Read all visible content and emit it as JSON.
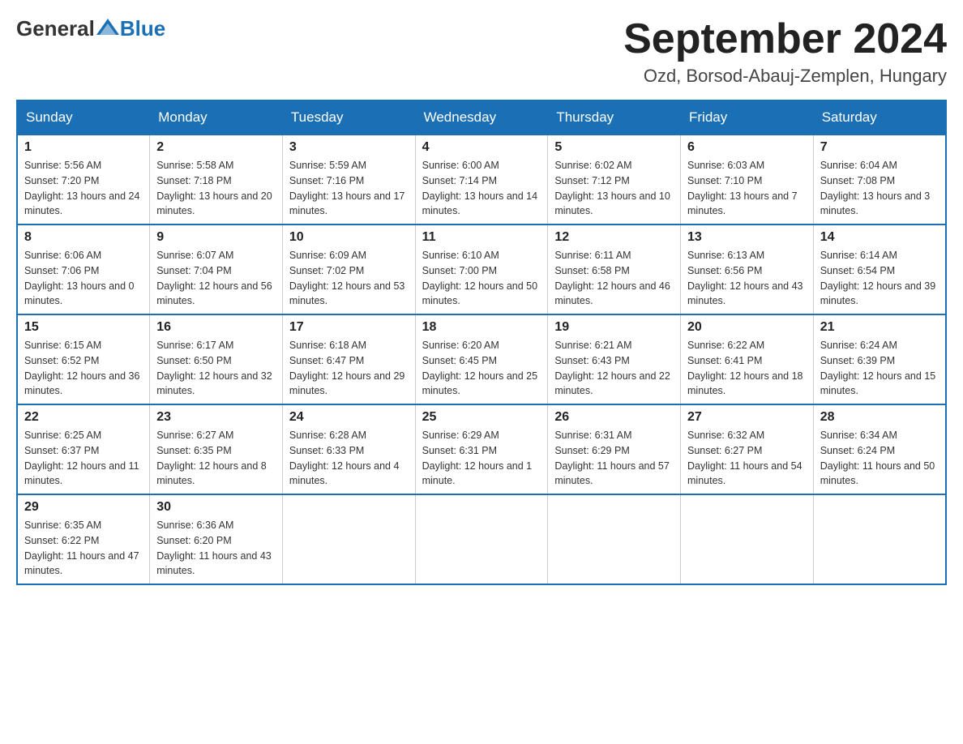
{
  "header": {
    "month_year": "September 2024",
    "location": "Ozd, Borsod-Abauj-Zemplen, Hungary",
    "logo_general": "General",
    "logo_blue": "Blue"
  },
  "days_of_week": [
    "Sunday",
    "Monday",
    "Tuesday",
    "Wednesday",
    "Thursday",
    "Friday",
    "Saturday"
  ],
  "weeks": [
    [
      {
        "day": "1",
        "sunrise": "Sunrise: 5:56 AM",
        "sunset": "Sunset: 7:20 PM",
        "daylight": "Daylight: 13 hours and 24 minutes."
      },
      {
        "day": "2",
        "sunrise": "Sunrise: 5:58 AM",
        "sunset": "Sunset: 7:18 PM",
        "daylight": "Daylight: 13 hours and 20 minutes."
      },
      {
        "day": "3",
        "sunrise": "Sunrise: 5:59 AM",
        "sunset": "Sunset: 7:16 PM",
        "daylight": "Daylight: 13 hours and 17 minutes."
      },
      {
        "day": "4",
        "sunrise": "Sunrise: 6:00 AM",
        "sunset": "Sunset: 7:14 PM",
        "daylight": "Daylight: 13 hours and 14 minutes."
      },
      {
        "day": "5",
        "sunrise": "Sunrise: 6:02 AM",
        "sunset": "Sunset: 7:12 PM",
        "daylight": "Daylight: 13 hours and 10 minutes."
      },
      {
        "day": "6",
        "sunrise": "Sunrise: 6:03 AM",
        "sunset": "Sunset: 7:10 PM",
        "daylight": "Daylight: 13 hours and 7 minutes."
      },
      {
        "day": "7",
        "sunrise": "Sunrise: 6:04 AM",
        "sunset": "Sunset: 7:08 PM",
        "daylight": "Daylight: 13 hours and 3 minutes."
      }
    ],
    [
      {
        "day": "8",
        "sunrise": "Sunrise: 6:06 AM",
        "sunset": "Sunset: 7:06 PM",
        "daylight": "Daylight: 13 hours and 0 minutes."
      },
      {
        "day": "9",
        "sunrise": "Sunrise: 6:07 AM",
        "sunset": "Sunset: 7:04 PM",
        "daylight": "Daylight: 12 hours and 56 minutes."
      },
      {
        "day": "10",
        "sunrise": "Sunrise: 6:09 AM",
        "sunset": "Sunset: 7:02 PM",
        "daylight": "Daylight: 12 hours and 53 minutes."
      },
      {
        "day": "11",
        "sunrise": "Sunrise: 6:10 AM",
        "sunset": "Sunset: 7:00 PM",
        "daylight": "Daylight: 12 hours and 50 minutes."
      },
      {
        "day": "12",
        "sunrise": "Sunrise: 6:11 AM",
        "sunset": "Sunset: 6:58 PM",
        "daylight": "Daylight: 12 hours and 46 minutes."
      },
      {
        "day": "13",
        "sunrise": "Sunrise: 6:13 AM",
        "sunset": "Sunset: 6:56 PM",
        "daylight": "Daylight: 12 hours and 43 minutes."
      },
      {
        "day": "14",
        "sunrise": "Sunrise: 6:14 AM",
        "sunset": "Sunset: 6:54 PM",
        "daylight": "Daylight: 12 hours and 39 minutes."
      }
    ],
    [
      {
        "day": "15",
        "sunrise": "Sunrise: 6:15 AM",
        "sunset": "Sunset: 6:52 PM",
        "daylight": "Daylight: 12 hours and 36 minutes."
      },
      {
        "day": "16",
        "sunrise": "Sunrise: 6:17 AM",
        "sunset": "Sunset: 6:50 PM",
        "daylight": "Daylight: 12 hours and 32 minutes."
      },
      {
        "day": "17",
        "sunrise": "Sunrise: 6:18 AM",
        "sunset": "Sunset: 6:47 PM",
        "daylight": "Daylight: 12 hours and 29 minutes."
      },
      {
        "day": "18",
        "sunrise": "Sunrise: 6:20 AM",
        "sunset": "Sunset: 6:45 PM",
        "daylight": "Daylight: 12 hours and 25 minutes."
      },
      {
        "day": "19",
        "sunrise": "Sunrise: 6:21 AM",
        "sunset": "Sunset: 6:43 PM",
        "daylight": "Daylight: 12 hours and 22 minutes."
      },
      {
        "day": "20",
        "sunrise": "Sunrise: 6:22 AM",
        "sunset": "Sunset: 6:41 PM",
        "daylight": "Daylight: 12 hours and 18 minutes."
      },
      {
        "day": "21",
        "sunrise": "Sunrise: 6:24 AM",
        "sunset": "Sunset: 6:39 PM",
        "daylight": "Daylight: 12 hours and 15 minutes."
      }
    ],
    [
      {
        "day": "22",
        "sunrise": "Sunrise: 6:25 AM",
        "sunset": "Sunset: 6:37 PM",
        "daylight": "Daylight: 12 hours and 11 minutes."
      },
      {
        "day": "23",
        "sunrise": "Sunrise: 6:27 AM",
        "sunset": "Sunset: 6:35 PM",
        "daylight": "Daylight: 12 hours and 8 minutes."
      },
      {
        "day": "24",
        "sunrise": "Sunrise: 6:28 AM",
        "sunset": "Sunset: 6:33 PM",
        "daylight": "Daylight: 12 hours and 4 minutes."
      },
      {
        "day": "25",
        "sunrise": "Sunrise: 6:29 AM",
        "sunset": "Sunset: 6:31 PM",
        "daylight": "Daylight: 12 hours and 1 minute."
      },
      {
        "day": "26",
        "sunrise": "Sunrise: 6:31 AM",
        "sunset": "Sunset: 6:29 PM",
        "daylight": "Daylight: 11 hours and 57 minutes."
      },
      {
        "day": "27",
        "sunrise": "Sunrise: 6:32 AM",
        "sunset": "Sunset: 6:27 PM",
        "daylight": "Daylight: 11 hours and 54 minutes."
      },
      {
        "day": "28",
        "sunrise": "Sunrise: 6:34 AM",
        "sunset": "Sunset: 6:24 PM",
        "daylight": "Daylight: 11 hours and 50 minutes."
      }
    ],
    [
      {
        "day": "29",
        "sunrise": "Sunrise: 6:35 AM",
        "sunset": "Sunset: 6:22 PM",
        "daylight": "Daylight: 11 hours and 47 minutes."
      },
      {
        "day": "30",
        "sunrise": "Sunrise: 6:36 AM",
        "sunset": "Sunset: 6:20 PM",
        "daylight": "Daylight: 11 hours and 43 minutes."
      },
      null,
      null,
      null,
      null,
      null
    ]
  ]
}
